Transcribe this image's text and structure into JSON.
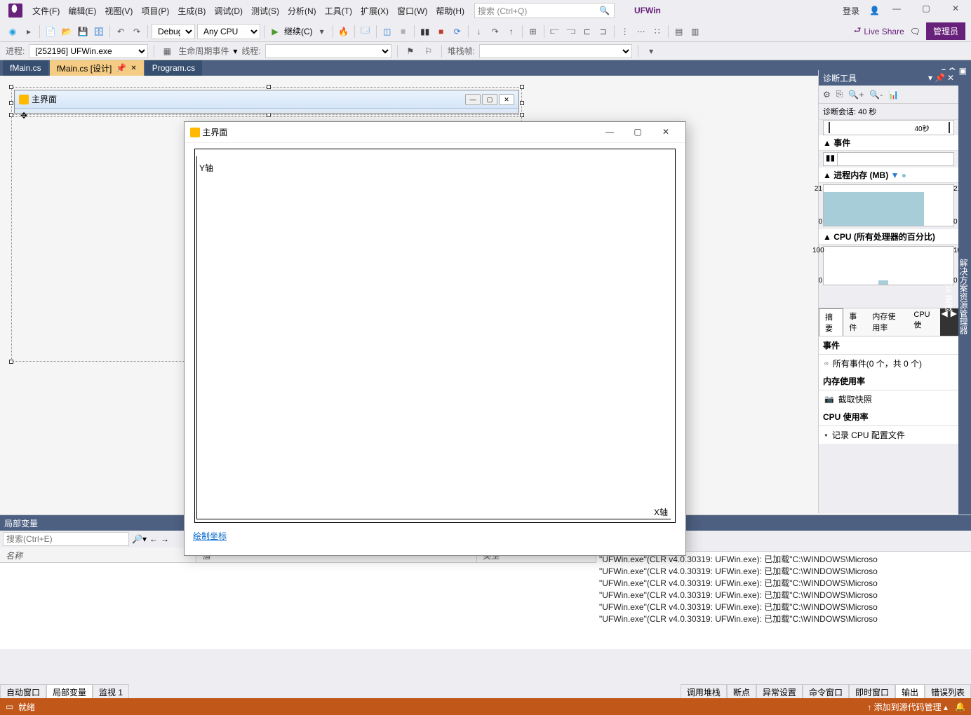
{
  "title": "UFWin",
  "login": "登录",
  "menu": [
    "文件(F)",
    "编辑(E)",
    "视图(V)",
    "项目(P)",
    "生成(B)",
    "调试(D)",
    "测试(S)",
    "分析(N)",
    "工具(T)",
    "扩展(X)",
    "窗口(W)",
    "帮助(H)"
  ],
  "search_placeholder": "搜索 (Ctrl+Q)",
  "toolbar": {
    "config": "Debug",
    "platform": "Any CPU",
    "continue": "继续(C)",
    "live_share": "Live Share",
    "admin": "管理员"
  },
  "toolbar2": {
    "process_label": "进程:",
    "process_value": "[252196] UFWin.exe",
    "lifecycle": "生命周期事件",
    "thread": "线程:",
    "stackframe": "堆栈帧:"
  },
  "tabs": [
    {
      "label": "fMain.cs",
      "active": false
    },
    {
      "label": "fMain.cs [设计]",
      "active": true,
      "pinned": true
    },
    {
      "label": "Program.cs",
      "active": false
    }
  ],
  "designer": {
    "form_title": "主界面"
  },
  "running": {
    "title": "主界面",
    "y_label": "Y轴",
    "x_label": "X轴",
    "link": "绘制坐标"
  },
  "diag": {
    "title": "诊断工具",
    "session": "诊断会话: 40 秒",
    "ruler_label": "40秒",
    "sections": {
      "events": "事件",
      "memory": "进程内存 (MB)",
      "cpu": "CPU (所有处理器的百分比)"
    },
    "mem_max": "21",
    "mem_min": "0",
    "cpu_max": "100",
    "cpu_min": "0",
    "tabs": [
      "摘要",
      "事件",
      "内存使用率",
      "CPU 使"
    ],
    "events_head": "事件",
    "all_events": "所有事件(0 个，共 0 个)",
    "mem_head": "内存使用率",
    "snapshot": "截取快照",
    "cpu_head": "CPU 使用率",
    "record": "记录 CPU 配置文件"
  },
  "locals": {
    "title": "局部变量",
    "search_placeholder": "搜索(Ctrl+E)",
    "cols": [
      "名称",
      "值",
      "类型"
    ]
  },
  "output_lines": [
    "\"UFWin.exe\"(CLR v4.0.30319: UFWin.exe): 已加载\"C:\\WINDOWS\\Microso",
    "\"UFWin.exe\"(CLR v4.0.30319: UFWin.exe): 已加载\"C:\\WINDOWS\\Microso",
    "\"UFWin.exe\"(CLR v4.0.30319: UFWin.exe): 已加载\"C:\\WINDOWS\\Microso",
    "\"UFWin.exe\"(CLR v4.0.30319: UFWin.exe): 已加载\"C:\\WINDOWS\\Microso",
    "\"UFWin.exe\"(CLR v4.0.30319: UFWin.exe): 已加载\"C:\\WINDOWS\\Microso",
    "\"UFWin.exe\"(CLR v4.0.30319: UFWin.exe): 已加载\"C:\\WINDOWS\\Microso"
  ],
  "bottom_tabs_left": [
    "自动窗口",
    "局部变量",
    "监视 1"
  ],
  "bottom_tabs_right": [
    "调用堆栈",
    "断点",
    "异常设置",
    "命令窗口",
    "即时窗口",
    "输出",
    "错误列表"
  ],
  "statusbar": {
    "ready": "就绪",
    "source": "添加到源代码管理"
  },
  "right_rail": [
    "解决方案资源管理器",
    "Git 更改"
  ]
}
